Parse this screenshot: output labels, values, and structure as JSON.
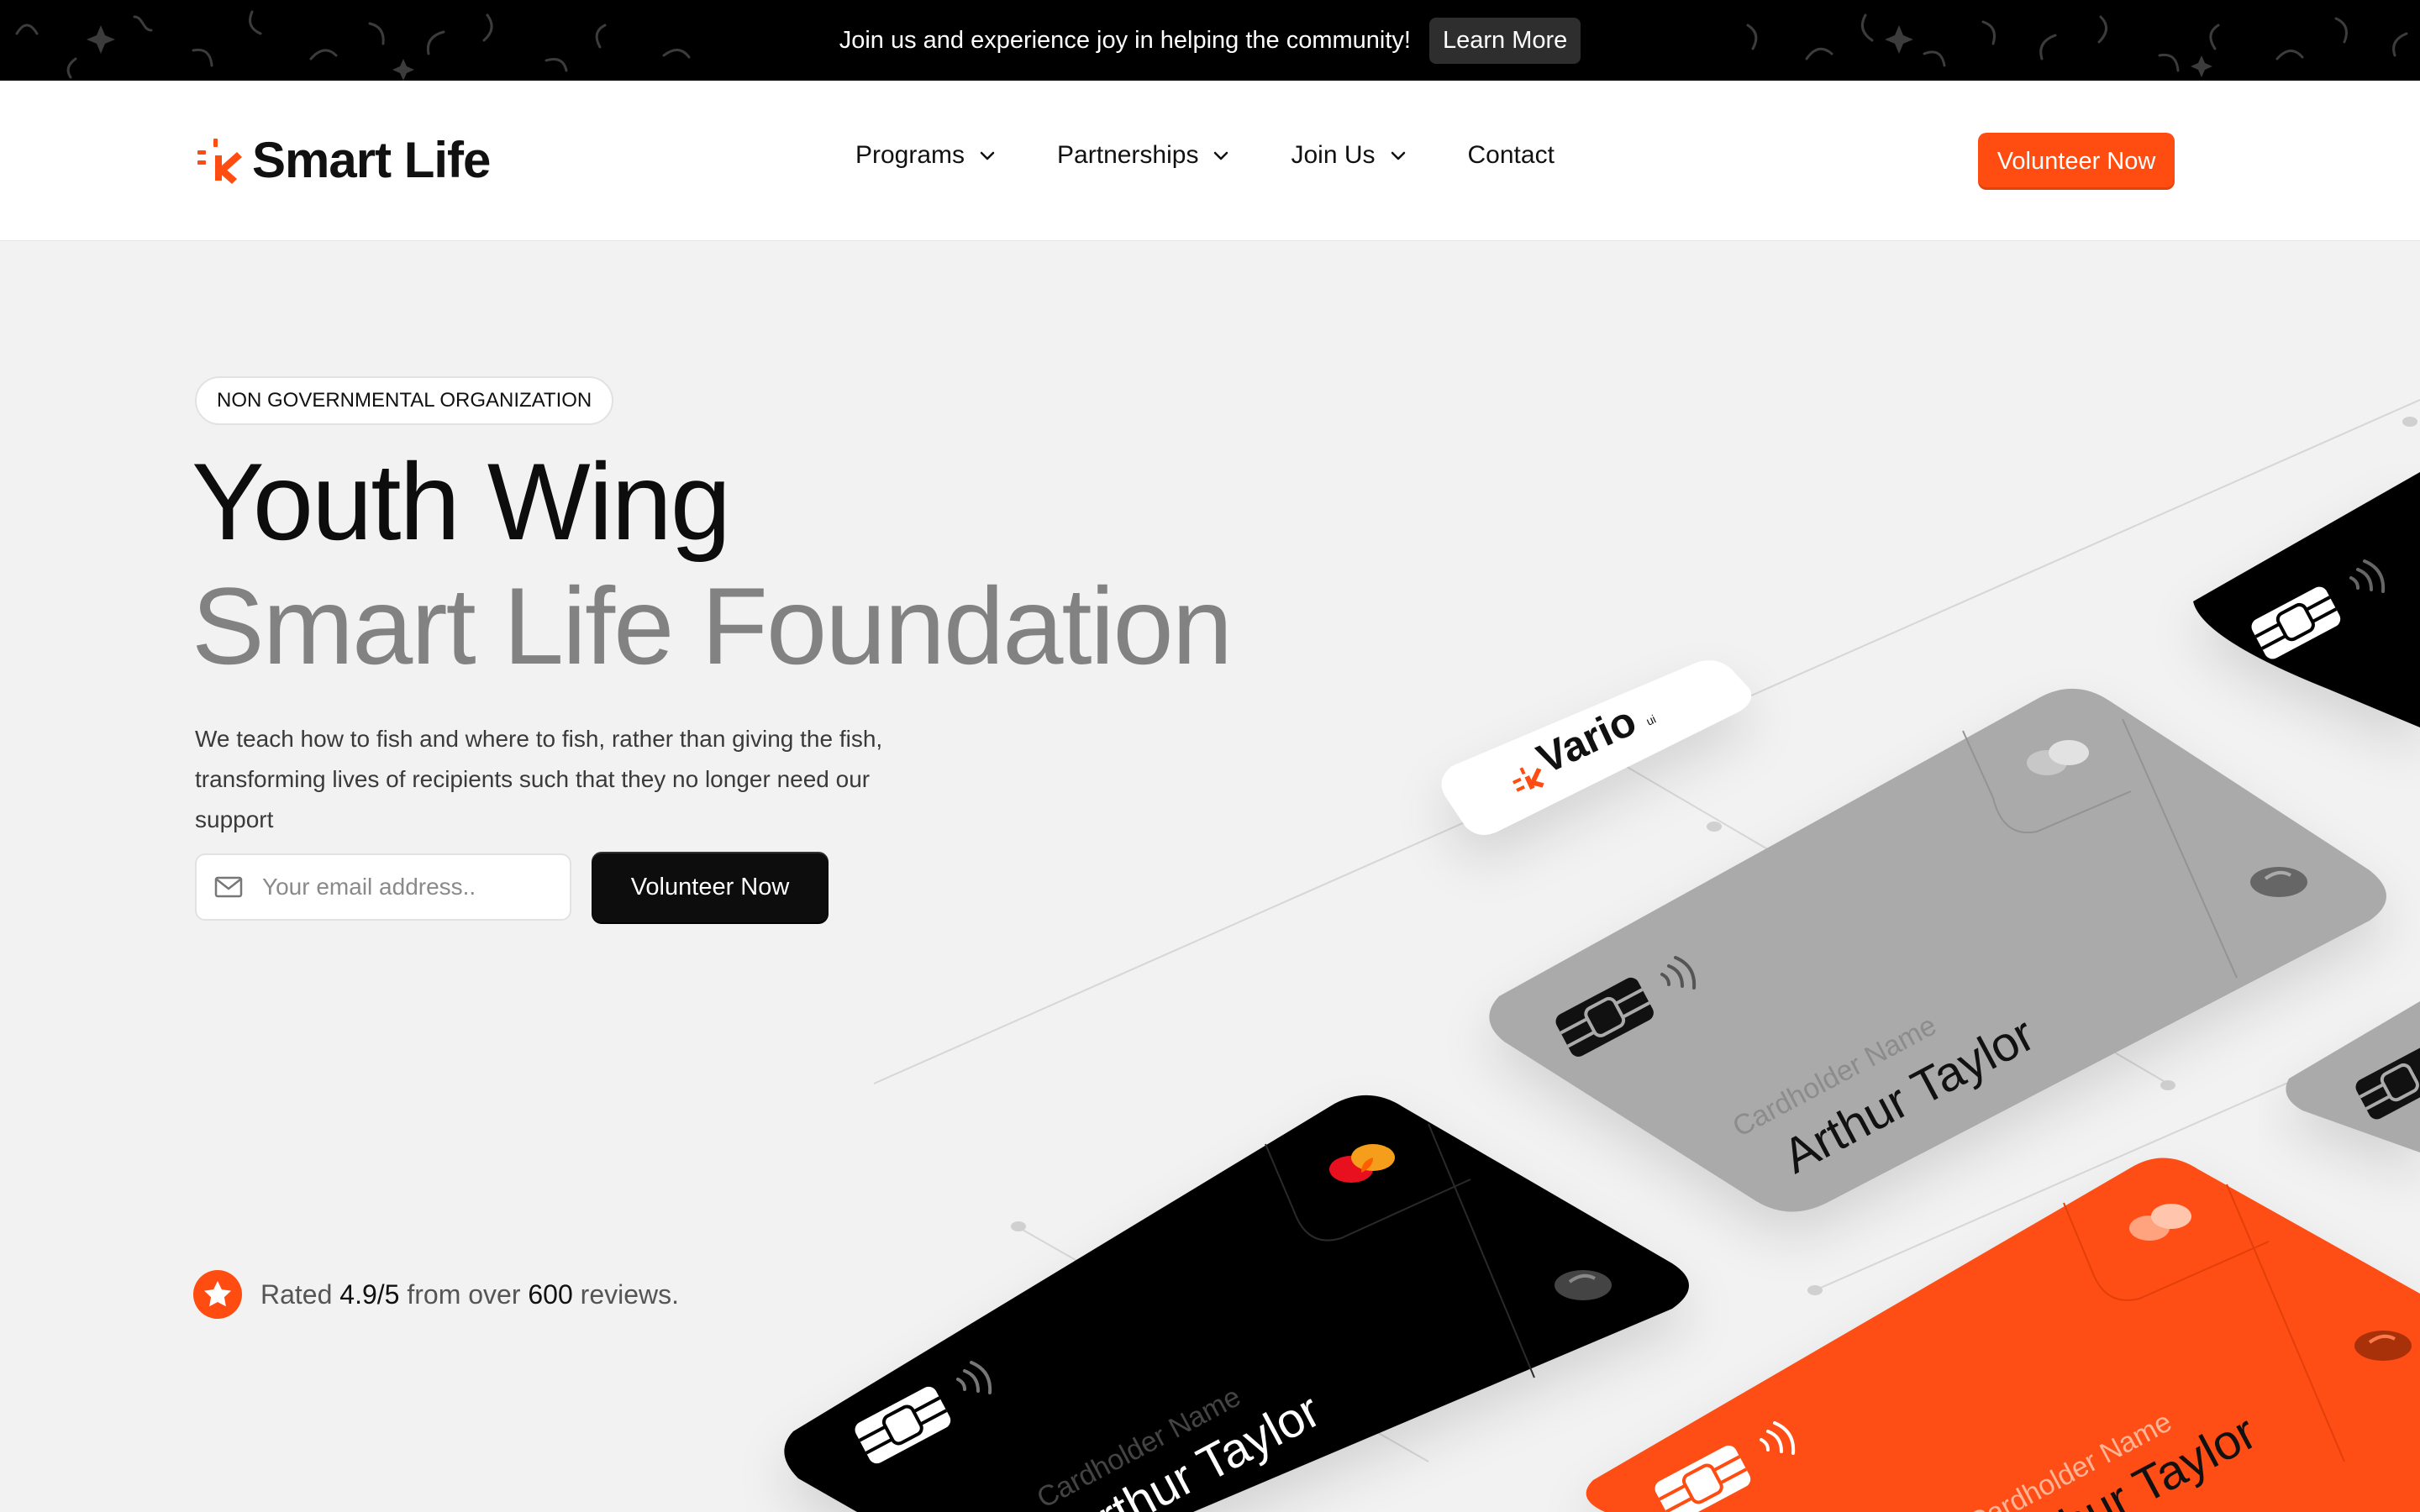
{
  "announcement": {
    "text": "Join us and experience joy in helping the community!",
    "button": "Learn More"
  },
  "brand": {
    "name": "Smart Life",
    "accent": "#ff4d12"
  },
  "nav": {
    "items": [
      {
        "label": "Programs",
        "has_dropdown": true
      },
      {
        "label": "Partnerships",
        "has_dropdown": true
      },
      {
        "label": "Join Us",
        "has_dropdown": true
      },
      {
        "label": "Contact",
        "has_dropdown": false
      }
    ],
    "cta": "Volunteer Now"
  },
  "hero": {
    "badge": "NON GOVERNMENTAL ORGANIZATION",
    "title_line1": "Youth Wing",
    "title_line2": "Smart Life Foundation",
    "description": "We teach how to fish and where to fish, rather than giving the fish, transforming lives of recipients such that they no longer need our support",
    "email_placeholder": "Your email address..",
    "cta": "Volunteer Now"
  },
  "rating": {
    "prefix": "Rated",
    "score": "4.9/5",
    "middle": "from over",
    "count": "600",
    "suffix": "reviews."
  },
  "illustration": {
    "tag_label": "Vario",
    "tag_superscript": "ui",
    "cardholder_caption": "Cardholder Name",
    "cardholder_name": "Arthur Taylor",
    "card_colors": [
      "#000000",
      "#aaaaaa",
      "#ff4d12"
    ]
  }
}
